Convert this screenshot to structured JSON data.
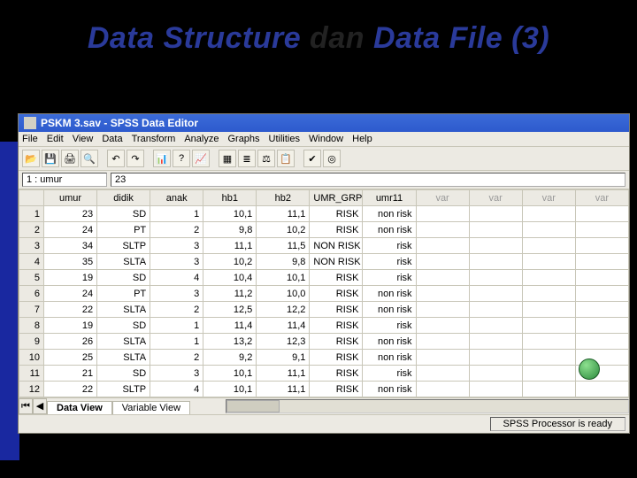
{
  "slide": {
    "title_a": "Data Structure",
    "title_mid": " dan ",
    "title_b": "Data File (3)"
  },
  "window": {
    "title": "PSKM 3.sav - SPSS Data Editor"
  },
  "menubar": [
    "File",
    "Edit",
    "View",
    "Data",
    "Transform",
    "Analyze",
    "Graphs",
    "Utilities",
    "Window",
    "Help"
  ],
  "toolbar_icons": [
    "📂",
    "💾",
    "🖨",
    "🔍",
    "↶",
    "↷",
    "📊",
    "?",
    "📈",
    "▦",
    "≣",
    "⚖",
    "📋",
    "✔",
    "◎"
  ],
  "cellbar": {
    "ref": "1 : umur",
    "value": "23"
  },
  "columns": [
    "umur",
    "didik",
    "anak",
    "hb1",
    "hb2",
    "UMR_GRP",
    "umr11",
    "var",
    "var",
    "var",
    "var"
  ],
  "emptycols": [
    7,
    8,
    9,
    10
  ],
  "rows": [
    {
      "n": "1",
      "c": [
        "23",
        "SD",
        "1",
        "10,1",
        "11,1",
        "RISK",
        "non risk",
        "",
        "",
        "",
        ""
      ]
    },
    {
      "n": "2",
      "c": [
        "24",
        "PT",
        "2",
        "9,8",
        "10,2",
        "RISK",
        "non risk",
        "",
        "",
        "",
        ""
      ]
    },
    {
      "n": "3",
      "c": [
        "34",
        "SLTP",
        "3",
        "11,1",
        "11,5",
        "NON RISK",
        "risk",
        "",
        "",
        "",
        ""
      ]
    },
    {
      "n": "4",
      "c": [
        "35",
        "SLTA",
        "3",
        "10,2",
        "9,8",
        "NON RISK",
        "risk",
        "",
        "",
        "",
        ""
      ]
    },
    {
      "n": "5",
      "c": [
        "19",
        "SD",
        "4",
        "10,4",
        "10,1",
        "RISK",
        "risk",
        "",
        "",
        "",
        ""
      ]
    },
    {
      "n": "6",
      "c": [
        "24",
        "PT",
        "3",
        "11,2",
        "10,0",
        "RISK",
        "non risk",
        "",
        "",
        "",
        ""
      ]
    },
    {
      "n": "7",
      "c": [
        "22",
        "SLTA",
        "2",
        "12,5",
        "12,2",
        "RISK",
        "non risk",
        "",
        "",
        "",
        ""
      ]
    },
    {
      "n": "8",
      "c": [
        "19",
        "SD",
        "1",
        "11,4",
        "11,4",
        "RISK",
        "risk",
        "",
        "",
        "",
        ""
      ]
    },
    {
      "n": "9",
      "c": [
        "26",
        "SLTA",
        "1",
        "13,2",
        "12,3",
        "RISK",
        "non risk",
        "",
        "",
        "",
        ""
      ]
    },
    {
      "n": "10",
      "c": [
        "25",
        "SLTA",
        "2",
        "9,2",
        "9,1",
        "RISK",
        "non risk",
        "",
        "",
        "",
        ""
      ]
    },
    {
      "n": "11",
      "c": [
        "21",
        "SD",
        "3",
        "10,1",
        "11,1",
        "RISK",
        "risk",
        "",
        "",
        "",
        ""
      ]
    },
    {
      "n": "12",
      "c": [
        "22",
        "SLTP",
        "4",
        "10,1",
        "11,1",
        "RISK",
        "non risk",
        "",
        "",
        "",
        ""
      ]
    }
  ],
  "tabs": {
    "data": "Data View",
    "variable": "Variable View"
  },
  "status": "SPSS Processor is ready"
}
